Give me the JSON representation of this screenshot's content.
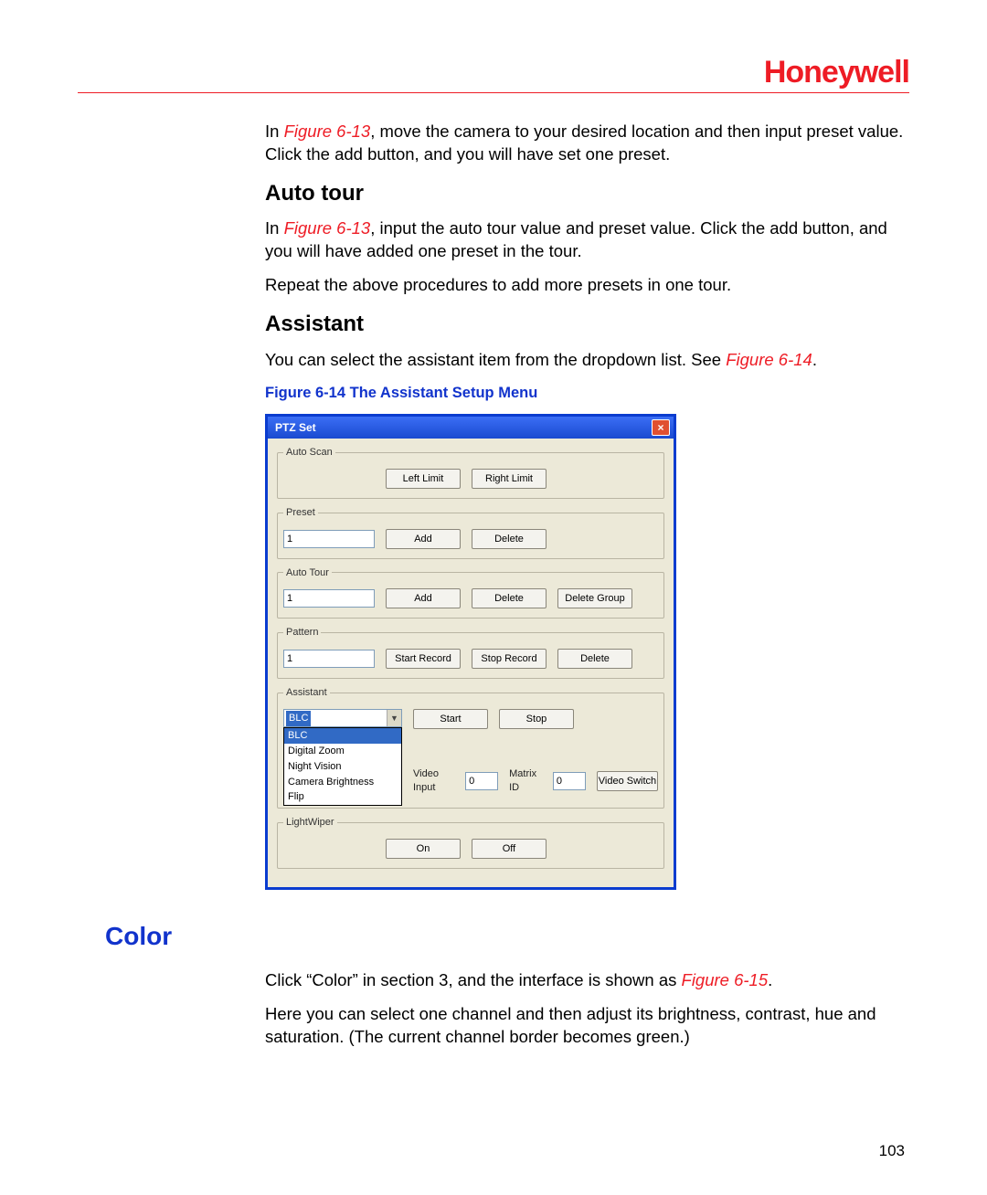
{
  "brand": "Honeywell",
  "page_number": "103",
  "intro": {
    "figref": "Figure 6-13",
    "text_before": "In ",
    "text_after": ", move the camera to your desired location and then input preset value. Click the add button, and you will have set one preset."
  },
  "autotour": {
    "heading": "Auto tour",
    "figref": "Figure 6-13",
    "p1_before": "In ",
    "p1_after": ", input the auto tour value and preset value. Click the add button, and you will have added one preset in the tour.",
    "p2": "Repeat the above procedures to add more presets in one tour."
  },
  "assistant": {
    "heading": "Assistant",
    "p1_before": "You can select the assistant item from the dropdown list. See ",
    "figref": "Figure 6-14",
    "p1_after": ".",
    "caption": "Figure 6-14 The Assistant Setup Menu"
  },
  "dialog": {
    "title": "PTZ Set",
    "close": "×",
    "groups": {
      "autoscan": {
        "legend": "Auto Scan",
        "left_limit": "Left Limit",
        "right_limit": "Right Limit"
      },
      "preset": {
        "legend": "Preset",
        "value": "1",
        "add": "Add",
        "delete": "Delete"
      },
      "autotour": {
        "legend": "Auto Tour",
        "value": "1",
        "add": "Add",
        "delete": "Delete",
        "delete_group": "Delete Group"
      },
      "pattern": {
        "legend": "Pattern",
        "value": "1",
        "start_record": "Start Record",
        "stop_record": "Stop Record",
        "delete": "Delete"
      },
      "assistant": {
        "legend": "Assistant",
        "selected": "BLC",
        "options": [
          "BLC",
          "Digital Zoom",
          "Night Vision",
          "Camera Brightness",
          "Flip"
        ],
        "start": "Start",
        "stop": "Stop"
      },
      "matrix": {
        "video_input_label": "Video Input",
        "video_input_value": "0",
        "matrix_id_label": "Matrix ID",
        "matrix_id_value": "0",
        "video_switch": "Video Switch"
      },
      "lightwiper": {
        "legend": "LightWiper",
        "on": "On",
        "off": "Off"
      }
    }
  },
  "color": {
    "heading": "Color",
    "p1_before": "Click “Color” in section 3, and the interface is shown as ",
    "figref": "Figure 6-15",
    "p1_after": ".",
    "p2": "Here you can select one channel and then adjust its brightness, contrast, hue and saturation. (The current channel border becomes green.)"
  }
}
